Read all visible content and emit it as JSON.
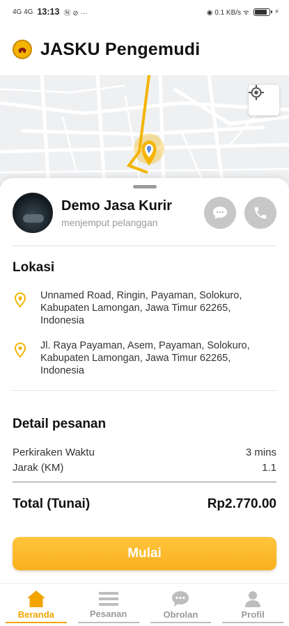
{
  "status_bar": {
    "left_glyphs": "4G 4G",
    "time": "13:13",
    "extra_glyphs": "Ⓝ ⊘ ···",
    "right_glyphs": "◉ 0.1 KB/s ᯤ",
    "battery_level": 0.9
  },
  "app": {
    "title": "JASKU Pengemudi",
    "brand_color": "#F8B01E"
  },
  "driver": {
    "name": "Demo Jasa Kurir",
    "status": "menjemput pelanggan"
  },
  "location": {
    "heading": "Lokasi",
    "items": [
      {
        "icon": "location-pin-icon",
        "address": "Unnamed Road, Ringin, Payaman, Solokuro, Kabupaten Lamongan, Jawa Timur 62265, Indonesia"
      },
      {
        "icon": "location-pin-icon",
        "address": "Jl. Raya Payaman, Asem, Payaman, Solokuro, Kabupaten Lamongan, Jawa Timur 62265, Indonesia"
      }
    ]
  },
  "order_detail": {
    "heading": "Detail pesanan",
    "rows": [
      {
        "label": "Perkiraken Waktu",
        "value": "3 mins"
      },
      {
        "label": "Jarak (KM)",
        "value": "1.1"
      }
    ],
    "total_label": "Total (Tunai)",
    "total_value": "Rp2.770.00"
  },
  "start_button": {
    "label": "Mulai"
  },
  "nav": {
    "items": [
      {
        "label": "Beranda",
        "icon": "home-icon",
        "active": true
      },
      {
        "label": "Pesanan",
        "icon": "list-icon",
        "active": false
      },
      {
        "label": "Obrolan",
        "icon": "chat-icon",
        "active": false
      },
      {
        "label": "Profil",
        "icon": "person-icon",
        "active": false
      }
    ]
  }
}
